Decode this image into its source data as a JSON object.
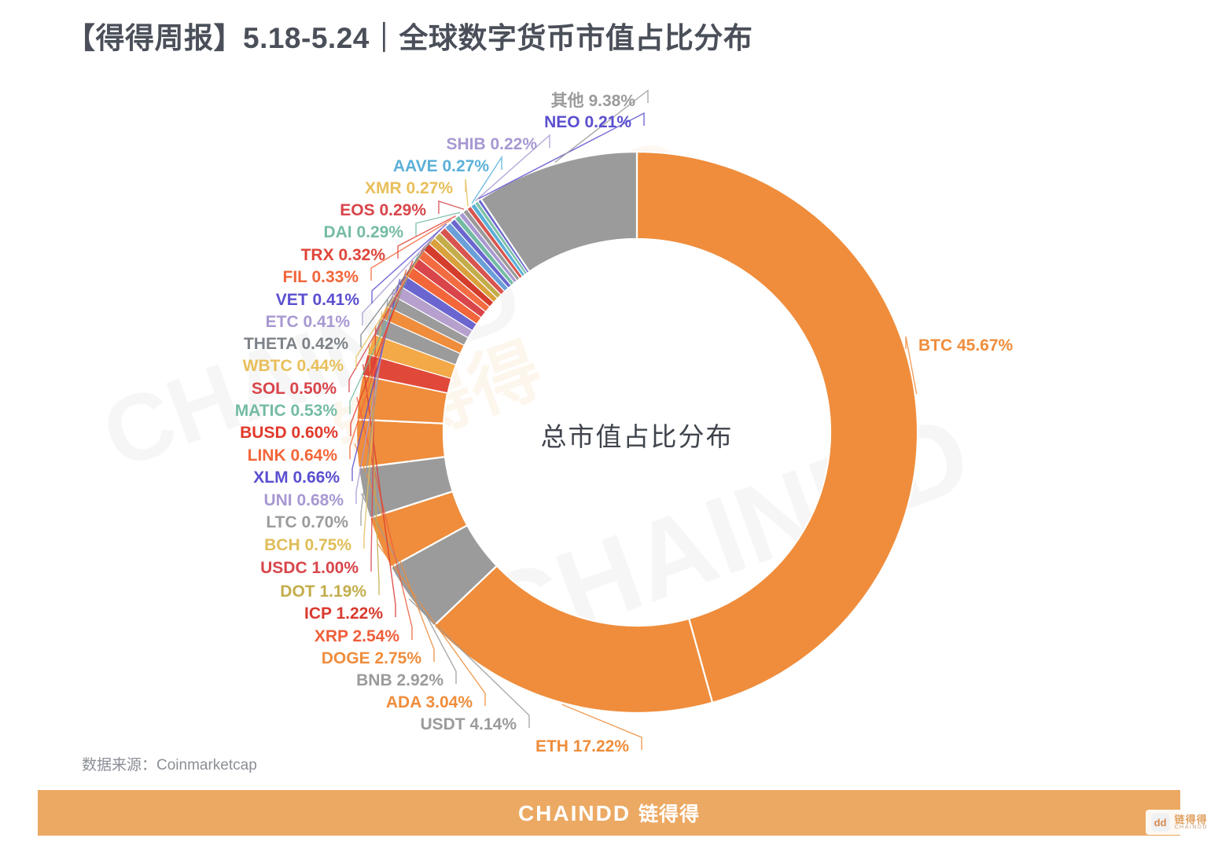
{
  "header": {
    "title": "【得得周报】5.18-5.24｜全球数字货币市值占比分布"
  },
  "center": {
    "label": "总市值占比分布"
  },
  "source": {
    "note": "数据来源：Coinmarketcap"
  },
  "footer": {
    "brand_en": "CHAINDD",
    "brand_cn": "链得得"
  },
  "corner_badge": {
    "mark": "dd",
    "name": "链得得",
    "sub": "CHAINDD"
  },
  "watermarks": {
    "w1": "CHAINDD",
    "w2": "CHAINDD",
    "w3": "DD",
    "w4": "链得得"
  },
  "colors": {
    "title": "#4a4f59",
    "footer_bg": "#eca963",
    "orange": "#ef8d3c",
    "gray": "#9b9b9b"
  },
  "chart_data": {
    "type": "pie",
    "title": "【得得周报】5.18-5.24｜全球数字货币市值占比分布",
    "subtitle": "总市值占比分布",
    "donut": true,
    "start_angle_deg": 0,
    "direction": "clockwise",
    "unit": "%",
    "source": "Coinmarketcap",
    "legend": "none",
    "labels_outside": true,
    "categories": [
      "BTC",
      "ETH",
      "USDT",
      "ADA",
      "BNB",
      "DOGE",
      "XRP",
      "ICP",
      "DOT",
      "USDC",
      "BCH",
      "LTC",
      "UNI",
      "XLM",
      "LINK",
      "BUSD",
      "MATIC",
      "SOL",
      "WBTC",
      "THETA",
      "ETC",
      "VET",
      "FIL",
      "TRX",
      "DAI",
      "EOS",
      "XMR",
      "AAVE",
      "SHIB",
      "NEO",
      "其他"
    ],
    "values": [
      45.67,
      17.22,
      4.14,
      3.04,
      2.92,
      2.75,
      2.54,
      1.22,
      1.19,
      1.0,
      0.75,
      0.7,
      0.68,
      0.66,
      0.64,
      0.6,
      0.53,
      0.5,
      0.44,
      0.42,
      0.41,
      0.41,
      0.33,
      0.32,
      0.29,
      0.29,
      0.27,
      0.27,
      0.22,
      0.21,
      9.38
    ],
    "slice_colors": [
      "#ef8d3c",
      "#ef8d3c",
      "#9b9b9b",
      "#ef8d3c",
      "#9b9b9b",
      "#ef8d3c",
      "#ef8d3c",
      "#e0483a",
      "#f3a948",
      "#9b9b9b",
      "#ef8d3c",
      "#9b9b9b",
      "#b6a0cd",
      "#6b66cf",
      "#f2663a",
      "#d8454a",
      "#f36c41",
      "#d43d2c",
      "#d9a13c",
      "#c3ad4b",
      "#d8544f",
      "#6a9fd8",
      "#6b66cf",
      "#74bba4",
      "#a898d2",
      "#9b9b9b",
      "#d8554f",
      "#5bb0d8",
      "#7ec2a8",
      "#6b66cf",
      "#9b9b9b"
    ],
    "label_colors": [
      "#ef8d3c",
      "#ef8d3c",
      "#9b9b9b",
      "#ef8d3c",
      "#9b9b9b",
      "#ef8d3c",
      "#ef5f3c",
      "#d93a30",
      "#c3ad4b",
      "#d8454a",
      "#e0bd5a",
      "#9b9b9b",
      "#a898d2",
      "#5a4fcf",
      "#f2663a",
      "#e0392a",
      "#74bba4",
      "#d8454a",
      "#e8bf5a",
      "#7d8288",
      "#a898d2",
      "#5a4fcf",
      "#f2663a",
      "#e0453a",
      "#74bba4",
      "#d8454a",
      "#e8bf5a",
      "#5bb0d8",
      "#a898d2",
      "#5a4fcf",
      "#9b9b9b"
    ],
    "data_labels": [
      {
        "name": "BTC",
        "text": "BTC 45.67%"
      },
      {
        "name": "ETH",
        "text": "ETH 17.22%"
      },
      {
        "name": "USDT",
        "text": "USDT 4.14%"
      },
      {
        "name": "ADA",
        "text": "ADA 3.04%"
      },
      {
        "name": "BNB",
        "text": "BNB 2.92%"
      },
      {
        "name": "DOGE",
        "text": "DOGE 2.75%"
      },
      {
        "name": "XRP",
        "text": "XRP 2.54%"
      },
      {
        "name": "ICP",
        "text": "ICP 1.22%"
      },
      {
        "name": "DOT",
        "text": "DOT 1.19%"
      },
      {
        "name": "USDC",
        "text": "USDC 1.00%"
      },
      {
        "name": "BCH",
        "text": "BCH 0.75%"
      },
      {
        "name": "LTC",
        "text": "LTC 0.70%"
      },
      {
        "name": "UNI",
        "text": "UNI 0.68%"
      },
      {
        "name": "XLM",
        "text": "XLM 0.66%"
      },
      {
        "name": "LINK",
        "text": "LINK 0.64%"
      },
      {
        "name": "BUSD",
        "text": "BUSD 0.60%"
      },
      {
        "name": "MATIC",
        "text": "MATIC 0.53%"
      },
      {
        "name": "SOL",
        "text": "SOL 0.50%"
      },
      {
        "name": "WBTC",
        "text": "WBTC 0.44%"
      },
      {
        "name": "THETA",
        "text": "THETA 0.42%"
      },
      {
        "name": "ETC",
        "text": "ETC 0.41%"
      },
      {
        "name": "VET",
        "text": "VET 0.41%"
      },
      {
        "name": "FIL",
        "text": "FIL 0.33%"
      },
      {
        "name": "TRX",
        "text": "TRX 0.32%"
      },
      {
        "name": "DAI",
        "text": "DAI 0.29%"
      },
      {
        "name": "EOS",
        "text": "EOS 0.29%"
      },
      {
        "name": "XMR",
        "text": "XMR 0.27%"
      },
      {
        "name": "AAVE",
        "text": "AAVE 0.27%"
      },
      {
        "name": "SHIB",
        "text": "SHIB 0.22%"
      },
      {
        "name": "NEO",
        "text": "NEO 0.21%"
      },
      {
        "name": "OTHER",
        "text": "其他 9.38%"
      }
    ]
  }
}
